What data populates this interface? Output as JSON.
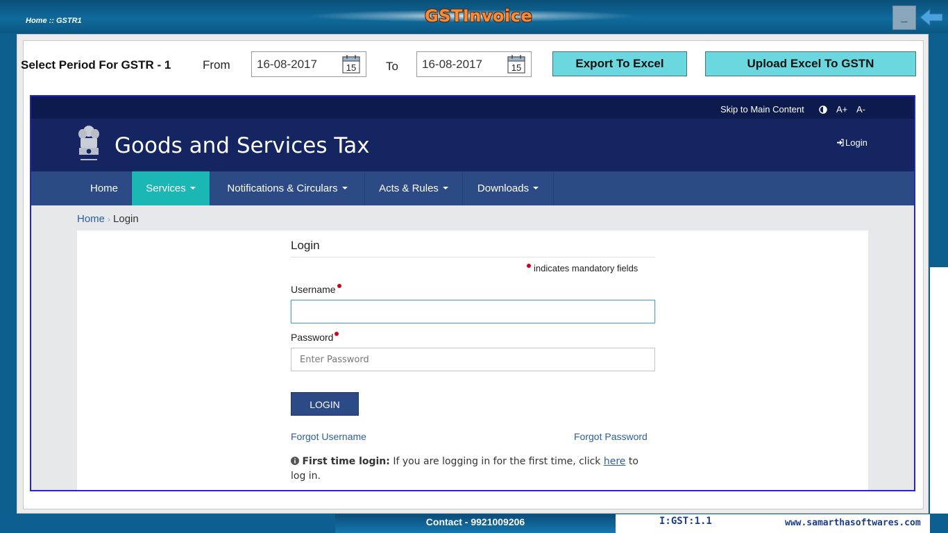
{
  "window": {
    "breadcrumb": "Home :: GSTR1",
    "app_title": "GSTInvoice",
    "minimize_label": "_"
  },
  "period": {
    "label": "Select Period For GSTR - 1",
    "from_label": "From",
    "from_value": "16-08-2017",
    "to_label": "To",
    "to_value": "16-08-2017",
    "calendar_day": "15"
  },
  "actions": {
    "export_label": "Export To Excel",
    "upload_label": "Upload Excel To GSTN"
  },
  "gst_portal": {
    "skip_label": "Skip to Main Content",
    "font_increase": "A+",
    "font_decrease": "A-",
    "site_title": "Goods and Services Tax",
    "login_link": "Login",
    "nav": [
      {
        "label": "Home"
      },
      {
        "label": "Services"
      },
      {
        "label": "Notifications & Circulars"
      },
      {
        "label": "Acts & Rules"
      },
      {
        "label": "Downloads"
      }
    ],
    "breadcrumb": {
      "home": "Home",
      "sep": "›",
      "current": "Login"
    },
    "login_form": {
      "title": "Login",
      "mandatory_note": "indicates mandatory fields",
      "username_label": "Username",
      "username_value": "",
      "password_label": "Password",
      "password_placeholder": "Enter Password",
      "submit_label": "LOGIN",
      "forgot_username": "Forgot Username",
      "forgot_password": "Forgot Password",
      "first_time_bold": "First time login:",
      "first_time_text": " If you are logging in for the first time, click ",
      "first_time_link": "here",
      "first_time_end": " to log in."
    }
  },
  "status_bar": {
    "contact": "Contact - 9921009206",
    "version": "I:GST:1.1",
    "website": "www.samarthasoftwares.com"
  },
  "colors": {
    "accent_teal": "#1bb7b5",
    "gst_navy": "#142562",
    "button_cyan": "#6ad8de",
    "title_orange": "#f58c3c"
  }
}
